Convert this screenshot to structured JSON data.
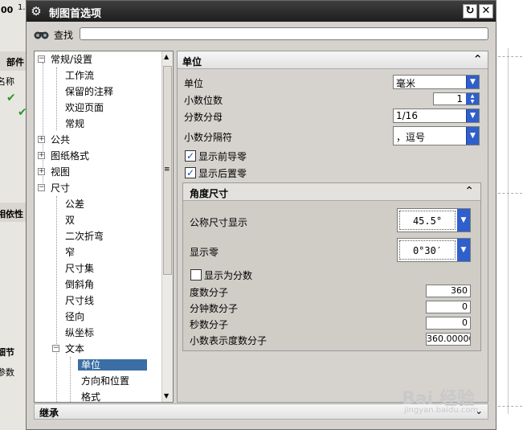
{
  "background": {
    "left_fragments": [
      "00",
      "1.",
      "部件",
      "名称",
      "相依性",
      "细节",
      "参数"
    ]
  },
  "dialog": {
    "title": "制图首选项",
    "icons": {
      "gear": "gear-icon",
      "reset": "reset-icon",
      "close": "close-icon"
    },
    "find": {
      "label": "查找",
      "value": ""
    },
    "tree": {
      "items": [
        {
          "label": "常规/设置",
          "level": 0,
          "expander": "minus"
        },
        {
          "label": "工作流",
          "level": 1
        },
        {
          "label": "保留的注释",
          "level": 1
        },
        {
          "label": "欢迎页面",
          "level": 1
        },
        {
          "label": "常规",
          "level": 1
        },
        {
          "label": "公共",
          "level": 0,
          "expander": "plus"
        },
        {
          "label": "图纸格式",
          "level": 0,
          "expander": "plus"
        },
        {
          "label": "视图",
          "level": 0,
          "expander": "plus"
        },
        {
          "label": "尺寸",
          "level": 0,
          "expander": "minus"
        },
        {
          "label": "公差",
          "level": 1
        },
        {
          "label": "双",
          "level": 1
        },
        {
          "label": "二次折弯",
          "level": 1
        },
        {
          "label": "窄",
          "level": 1
        },
        {
          "label": "尺寸集",
          "level": 1
        },
        {
          "label": "倒斜角",
          "level": 1
        },
        {
          "label": "尺寸线",
          "level": 1
        },
        {
          "label": "径向",
          "level": 1
        },
        {
          "label": "纵坐标",
          "level": 1
        },
        {
          "label": "文本",
          "level": 1,
          "expander": "minus"
        },
        {
          "label": "单位",
          "level": 2,
          "selected": true
        },
        {
          "label": "方向和位置",
          "level": 2
        },
        {
          "label": "格式",
          "level": 2
        }
      ]
    },
    "units": {
      "section_title": "单位",
      "unit_label": "单位",
      "unit_value": "毫米",
      "decimals_label": "小数位数",
      "decimals_value": "1",
      "fraction_label": "分数分母",
      "fraction_value": "1/16",
      "separator_label": "小数分隔符",
      "separator_value": "，逗号",
      "leading_zero_label": "显示前导零",
      "trailing_zero_label": "显示后置零"
    },
    "angle": {
      "section_title": "角度尺寸",
      "nominal_label": "公称尺寸显示",
      "nominal_value": "45.5°",
      "zero_label": "显示零",
      "zero_value": "0°30′",
      "fraction_label": "显示为分数",
      "deg_num_label": "度数分子",
      "deg_num_value": "360",
      "min_num_label": "分钟数分子",
      "min_num_value": "0",
      "sec_num_label": "秒数分子",
      "sec_num_value": "0",
      "dec_num_label": "小数表示度数分子",
      "dec_num_value": "360.00000"
    },
    "inherit_title": "继承"
  },
  "watermark": {
    "text": "Bai 经验",
    "sub": "jingyan.baidu.com"
  },
  "colors": {
    "title_bar": "#2a2a2a",
    "selection": "#3a6ea5",
    "dropdown": "#2e5fcc"
  }
}
